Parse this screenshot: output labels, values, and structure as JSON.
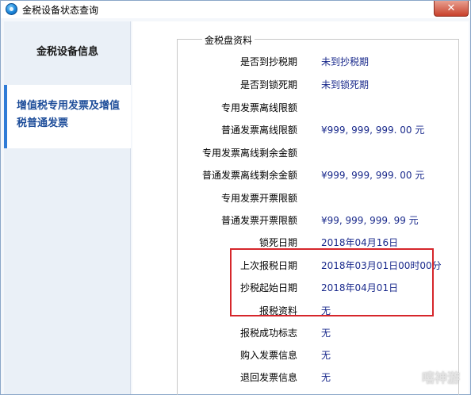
{
  "window": {
    "title": "金税设备状态查询",
    "close_symbol": "✕"
  },
  "sidebar": {
    "items": [
      {
        "label": "金税设备信息"
      },
      {
        "label": "增值税专用发票及增值税普通发票"
      }
    ]
  },
  "group": {
    "legend": "金税盘资料",
    "rows": [
      {
        "label": "是否到抄税期",
        "value": "未到抄税期"
      },
      {
        "label": "是否到锁死期",
        "value": "未到锁死期"
      },
      {
        "label": "专用发票离线限额",
        "value": ""
      },
      {
        "label": "普通发票离线限额",
        "value": "¥999, 999, 999. 00 元"
      },
      {
        "label": "专用发票离线剩余金额",
        "value": ""
      },
      {
        "label": "普通发票离线剩余金额",
        "value": "¥999, 999, 999. 00 元"
      },
      {
        "label": "专用发票开票限额",
        "value": ""
      },
      {
        "label": "普通发票开票限额",
        "value": "¥99, 999, 999. 99 元"
      },
      {
        "label": "锁死日期",
        "value": "2018年04月16日"
      },
      {
        "label": "上次报税日期",
        "value": "2018年03月01日00时00分"
      },
      {
        "label": "抄税起始日期",
        "value": "2018年04月01日"
      },
      {
        "label": "报税资料",
        "value": "无"
      },
      {
        "label": "报税成功标志",
        "value": "无"
      },
      {
        "label": "购入发票信息",
        "value": "无"
      },
      {
        "label": "退回发票信息",
        "value": "无"
      }
    ]
  },
  "watermark": "嘻神游",
  "colors": {
    "highlight_border": "#d6262b",
    "value_text": "#1a2a8c",
    "sidebar_selected_accent": "#2f7bd6"
  }
}
